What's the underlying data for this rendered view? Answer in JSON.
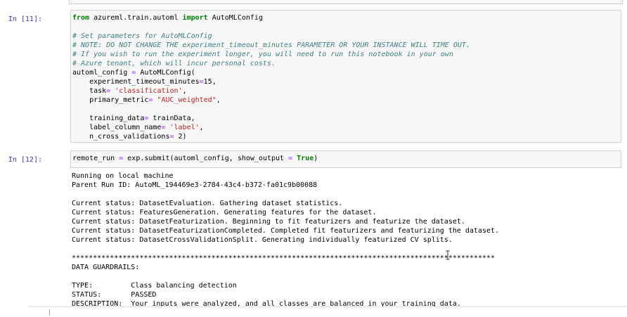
{
  "cells": [
    {
      "prompt": "In [11]:",
      "code": [
        [
          {
            "t": "from",
            "c": "kw"
          },
          {
            "t": " azureml.train.automl "
          },
          {
            "t": "import",
            "c": "kw"
          },
          {
            "t": " AutoMLConfig"
          }
        ],
        [
          {
            "t": ""
          }
        ],
        [
          {
            "t": "# Set parameters for AutoMLConfig",
            "c": "cm"
          }
        ],
        [
          {
            "t": "# NOTE: DO NOT CHANGE THE experiment_timeout_minutes PARAMETER OR YOUR INSTANCE WILL TIME OUT.",
            "c": "cm"
          }
        ],
        [
          {
            "t": "# If you wish to run the experiment longer, you will need to run this notebook in your own",
            "c": "cm"
          }
        ],
        [
          {
            "t": "# Azure tenant, which will incur personal costs.",
            "c": "cm"
          }
        ],
        [
          {
            "t": "automl_config "
          },
          {
            "t": "=",
            "c": "op"
          },
          {
            "t": " AutoMLConfig("
          }
        ],
        [
          {
            "t": "    experiment_timeout_minutes"
          },
          {
            "t": "=",
            "c": "op"
          },
          {
            "t": "15,"
          }
        ],
        [
          {
            "t": "    task"
          },
          {
            "t": "=",
            "c": "op"
          },
          {
            "t": " "
          },
          {
            "t": "'classification'",
            "c": "st"
          },
          {
            "t": ","
          }
        ],
        [
          {
            "t": "    primary_metric"
          },
          {
            "t": "=",
            "c": "op"
          },
          {
            "t": " "
          },
          {
            "t": "\"AUC_weighted\"",
            "c": "st"
          },
          {
            "t": ","
          }
        ],
        [
          {
            "t": ""
          }
        ],
        [
          {
            "t": "    training_data"
          },
          {
            "t": "=",
            "c": "op"
          },
          {
            "t": " trainData,"
          }
        ],
        [
          {
            "t": "    label_column_name"
          },
          {
            "t": "=",
            "c": "op"
          },
          {
            "t": " "
          },
          {
            "t": "'label'",
            "c": "st"
          },
          {
            "t": ","
          }
        ],
        [
          {
            "t": "    n_cross_validations"
          },
          {
            "t": "=",
            "c": "op"
          },
          {
            "t": " 2)"
          }
        ]
      ]
    },
    {
      "prompt": "In [12]:",
      "code": [
        [
          {
            "t": "remote_run "
          },
          {
            "t": "=",
            "c": "op"
          },
          {
            "t": " exp.submit(automl_config, show_output "
          },
          {
            "t": "=",
            "c": "op"
          },
          {
            "t": " "
          },
          {
            "t": "True",
            "c": "kw"
          },
          {
            "t": ")"
          }
        ]
      ],
      "output": [
        "Running on local machine",
        "Parent Run ID: AutoML_194469e3-2784-43c4-b372-fa01c9b00088",
        "",
        "Current status: DatasetEvaluation. Gathering dataset statistics.",
        "Current status: FeaturesGeneration. Generating features for the dataset.",
        "Current status: DatasetFeaturization. Beginning to fit featurizers and featurize the dataset.",
        "Current status: DatasetFeaturizationCompleted. Completed fit featurizers and featurizing the dataset.",
        "Current status: DatasetCrossValidationSplit. Generating individually featurized CV splits.",
        "",
        "****************************************************************************************************",
        "DATA GUARDRAILS:",
        "",
        "TYPE:         Class balancing detection",
        "STATUS:       PASSED",
        "DESCRIPTION:  Your inputs were analyzed, and all classes are balanced in your training data."
      ]
    }
  ]
}
